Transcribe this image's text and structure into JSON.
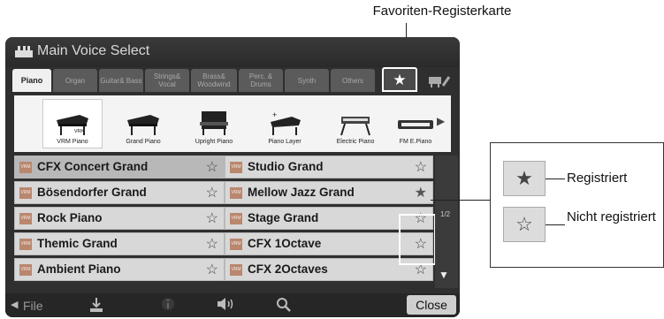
{
  "callouts": {
    "favorite_tab": "Favoriten-Registerkarte",
    "registered": "Registriert",
    "not_registered": "Nicht registriert"
  },
  "window": {
    "title": "Main Voice Select",
    "title_icon": "keyboard-icon"
  },
  "tabs": [
    {
      "label": "Piano",
      "active": true
    },
    {
      "label": "Organ"
    },
    {
      "label": "Guitar& Bass"
    },
    {
      "label": "Strings& Vocal"
    },
    {
      "label": "Brass& Woodwind"
    },
    {
      "label": "Perc. & Drums"
    },
    {
      "label": "Synth"
    },
    {
      "label": "Others"
    },
    {
      "label": "★",
      "favorite": true
    }
  ],
  "categories": [
    {
      "label": "VRM Piano",
      "selected": true
    },
    {
      "label": "Grand Piano"
    },
    {
      "label": "Upright Piano"
    },
    {
      "label": "Piano Layer"
    },
    {
      "label": "Electric Piano"
    },
    {
      "label": "FM E.Piano"
    }
  ],
  "voices_left": [
    {
      "name": "CFX Concert Grand",
      "badge": "VRM",
      "star": "☆",
      "selected": true
    },
    {
      "name": "Bösendorfer Grand",
      "badge": "VRM",
      "star": "☆"
    },
    {
      "name": "Rock Piano",
      "badge": "VRM",
      "star": "☆"
    },
    {
      "name": "Themic Grand",
      "badge": "VRM",
      "star": "☆"
    },
    {
      "name": "Ambient Piano",
      "badge": "VRM",
      "star": "☆"
    }
  ],
  "voices_right": [
    {
      "name": "Studio Grand",
      "badge": "VRM",
      "star": "☆"
    },
    {
      "name": "Mellow Jazz Grand",
      "badge": "VRM",
      "star": "★"
    },
    {
      "name": "Stage Grand",
      "badge": "VRM",
      "star": "☆"
    },
    {
      "name": "CFX 1Octave",
      "badge": "VRM",
      "star": "☆"
    },
    {
      "name": "CFX 2Octaves",
      "badge": "VRM",
      "star": "☆"
    }
  ],
  "pager": {
    "indicator": "1/2",
    "next_glyph": "▶",
    "down_glyph": "▼"
  },
  "bottom": {
    "file_label": "File",
    "close_label": "Close"
  },
  "legend": {
    "filled_star": "★",
    "empty_star": "☆"
  },
  "colors": {
    "screen_bg": "#2f2f2f",
    "row_bg": "#d8d8d8",
    "vrm_badge": "#b9876e"
  }
}
